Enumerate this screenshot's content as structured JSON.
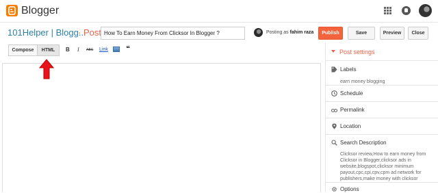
{
  "header": {
    "brand": "Blogger"
  },
  "post": {
    "blog_name": "101Helper | Blogg...",
    "separator": "· Post",
    "title_value": "How To Earn Money From Clicksor In Blogger ?",
    "posting_as_label": "Posting as",
    "posting_as_name": "fahim raza"
  },
  "actions": {
    "publish": "Publish",
    "save": "Save",
    "preview": "Preview",
    "close": "Close"
  },
  "toolbar": {
    "compose": "Compose",
    "html": "HTML",
    "bold": "B",
    "italic": "I",
    "strike": "ABC",
    "link": "Link",
    "quote": "❝"
  },
  "settings": {
    "title": "Post settings",
    "labels_title": "Labels",
    "labels_value": "earn money blogging",
    "schedule": "Schedule",
    "permalink": "Permalink",
    "location": "Location",
    "search_description_title": "Search Description",
    "search_description_value": "Clicksor review,How to earn money from Clicksor in Blogger,clicksor ads in website,blogspot,clicksor minimum payout,cpc,cpi,cpv,cpm ad network for publishers,make money with clicksor",
    "options": "Options"
  },
  "colors": {
    "accent": "#e5624a",
    "publish": "#f4633c",
    "blog_name": "#2e7fa8",
    "arrow": "#e8141c"
  }
}
